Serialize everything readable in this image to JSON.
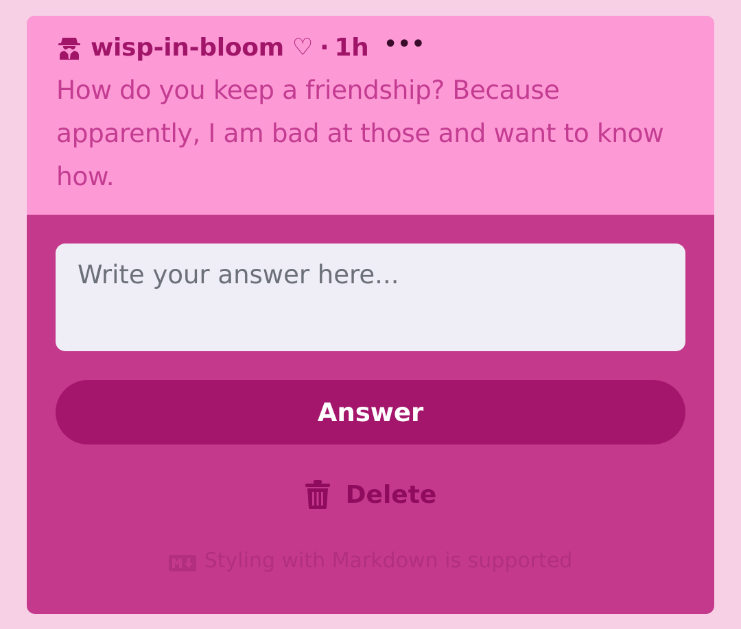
{
  "question": {
    "username": "wisp-in-bloom",
    "heart": "♡",
    "separator": "·",
    "time": "1h",
    "more": "•••",
    "text": "How do you keep a friendship? Because apparently, I am bad at those and want to know how.",
    "author_icon": "anonymous-spy-icon"
  },
  "answer": {
    "placeholder": "Write your answer here...",
    "value": "",
    "submit_label": "Answer",
    "delete_label": "Delete",
    "delete_icon": "trash-icon",
    "markdown_note": "Styling with Markdown is supported",
    "markdown_icon": "markdown-icon"
  },
  "colors": {
    "page_bg": "#f7d0e6",
    "question_bg": "#fd9ad6",
    "answer_bg": "#c4398c",
    "accent": "#a3166b"
  }
}
